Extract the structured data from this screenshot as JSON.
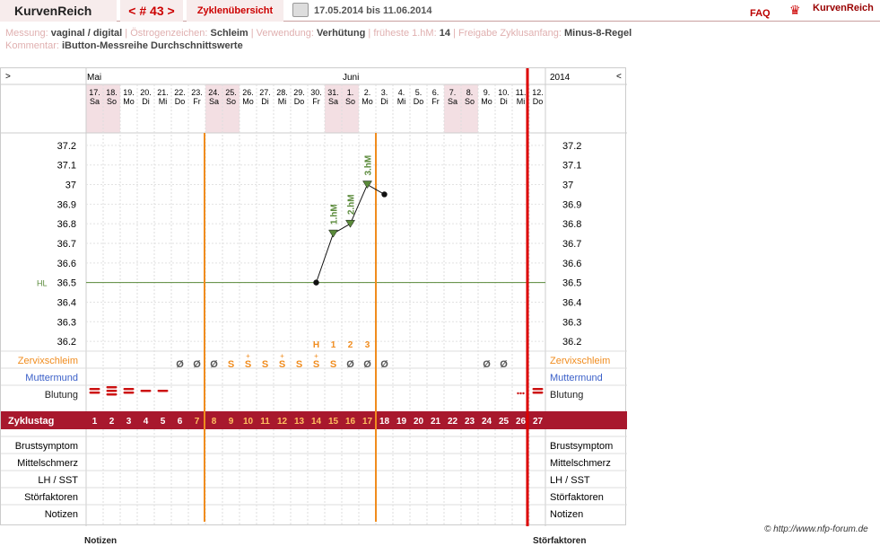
{
  "header": {
    "brand": "KurvenReich",
    "cycle_nav": "< # 43 >",
    "overview": "Zyklenübersicht",
    "date_range": "17.05.2014 bis 11.06.2014",
    "faq": "FAQ",
    "logo": "KurvenReich"
  },
  "meta": {
    "messung_label": "Messung:",
    "messung": "vaginal / digital",
    "oestrogen_label": "Östrogenzeichen:",
    "oestrogen": "Schleim",
    "verwendung_label": "Verwendung:",
    "verwendung": "Verhütung",
    "hm_label": "früheste 1.hM:",
    "hm": "14",
    "freigabe_label": "Freigabe Zyklusanfang:",
    "freigabe": "Minus-8-Regel",
    "kommentar_label": "Kommentar:",
    "kommentar": "iButton-Messreihe Durchschnittswerte"
  },
  "grid": {
    "nav_left": ">",
    "nav_right": "<",
    "year": "2014",
    "months": [
      {
        "label": "Mai",
        "col": 0
      },
      {
        "label": "Juni",
        "col": 15
      }
    ],
    "days": [
      [
        "17.",
        "Sa"
      ],
      [
        "18.",
        "So"
      ],
      [
        "19.",
        "Mo"
      ],
      [
        "20.",
        "Di"
      ],
      [
        "21.",
        "Mi"
      ],
      [
        "22.",
        "Do"
      ],
      [
        "23.",
        "Fr"
      ],
      [
        "24.",
        "Sa"
      ],
      [
        "25.",
        "So"
      ],
      [
        "26.",
        "Mo"
      ],
      [
        "27.",
        "Di"
      ],
      [
        "28.",
        "Mi"
      ],
      [
        "29.",
        "Do"
      ],
      [
        "30.",
        "Fr"
      ],
      [
        "31.",
        "Sa"
      ],
      [
        "1.",
        "So"
      ],
      [
        "2.",
        "Mo"
      ],
      [
        "3.",
        "Di"
      ],
      [
        "4.",
        "Mi"
      ],
      [
        "5.",
        "Do"
      ],
      [
        "6.",
        "Fr"
      ],
      [
        "7.",
        "Sa"
      ],
      [
        "8.",
        "So"
      ],
      [
        "9.",
        "Mo"
      ],
      [
        "10.",
        "Di"
      ],
      [
        "11.",
        "Mi"
      ],
      [
        "12.",
        "Do"
      ]
    ],
    "weekend_cols": [
      0,
      1,
      7,
      8,
      14,
      15,
      21,
      22
    ],
    "temp_ticks": [
      "37.2",
      "37.1",
      "37",
      "36.9",
      "36.8",
      "36.7",
      "36.6",
      "36.5",
      "36.4",
      "36.3",
      "36.2"
    ],
    "hl_label": "HL",
    "row_labels_left": {
      "zervix": "Zervixschleim",
      "muttermund": "Muttermund",
      "blutung": "Blutung",
      "zyklustag": "Zyklustag",
      "brust": "Brustsymptom",
      "mittel": "Mittelschmerz",
      "lh": "LH / SST",
      "stoer": "Störfaktoren",
      "notizen": "Notizen"
    },
    "row_labels_right": {
      "zervix": "Zervixschleim",
      "muttermund": "Muttermund",
      "blutung": "Blutung",
      "brust": "Brustsymptom",
      "mittel": "Mittelschmerz",
      "lh": "LH / SST",
      "stoer": "Störfaktoren",
      "notizen": "Notizen"
    },
    "cycle_days": [
      "1",
      "2",
      "3",
      "4",
      "5",
      "6",
      "7",
      "8",
      "9",
      "10",
      "11",
      "12",
      "13",
      "14",
      "15",
      "16",
      "17",
      "18",
      "19",
      "20",
      "21",
      "22",
      "23",
      "24",
      "25",
      "26",
      "27"
    ],
    "h_markers": [
      {
        "col": 13,
        "label": "H"
      },
      {
        "col": 14,
        "label": "1"
      },
      {
        "col": 15,
        "label": "2"
      },
      {
        "col": 16,
        "label": "3"
      }
    ],
    "zervix": [
      {
        "col": 5,
        "s": "Ø"
      },
      {
        "col": 6,
        "s": "Ø"
      },
      {
        "col": 7,
        "s": "Ø"
      },
      {
        "col": 8,
        "s": "S"
      },
      {
        "col": 9,
        "s": "S+"
      },
      {
        "col": 10,
        "s": "S"
      },
      {
        "col": 11,
        "s": "S+"
      },
      {
        "col": 12,
        "s": "S"
      },
      {
        "col": 13,
        "s": "S+"
      },
      {
        "col": 14,
        "s": "S"
      },
      {
        "col": 15,
        "s": "Ø"
      },
      {
        "col": 16,
        "s": "Ø"
      },
      {
        "col": 17,
        "s": "Ø"
      },
      {
        "col": 23,
        "s": "Ø"
      },
      {
        "col": 24,
        "s": "Ø"
      }
    ],
    "bleeding": [
      {
        "col": 0,
        "lvl": 2
      },
      {
        "col": 1,
        "lvl": 3
      },
      {
        "col": 2,
        "lvl": 2
      },
      {
        "col": 3,
        "lvl": 1
      },
      {
        "col": 4,
        "lvl": 1
      },
      {
        "col": 25,
        "lvl": 0
      },
      {
        "col": 26,
        "lvl": 2
      }
    ],
    "colors": {
      "accent": "#a00020",
      "orange": "#f08c1e",
      "green": "#5a8a3a",
      "red": "#cc1111"
    }
  },
  "chart_data": {
    "type": "line",
    "x": [
      "30.",
      "31.",
      "1.",
      "2.",
      "3."
    ],
    "series": [
      {
        "values": [
          36.5,
          36.75,
          36.8,
          37.0,
          36.95
        ]
      }
    ],
    "hm_labels": [
      {
        "x": "31.",
        "label": "1.hM"
      },
      {
        "x": "1.",
        "label": "2.hM"
      },
      {
        "x": "2.",
        "label": "3.hM"
      }
    ],
    "hl_value": 36.5,
    "ylim": [
      36.15,
      37.25
    ]
  },
  "copyright": "© http://www.nfp-forum.de",
  "footer": {
    "notizen": "Notizen",
    "stoer": "Störfaktoren"
  }
}
